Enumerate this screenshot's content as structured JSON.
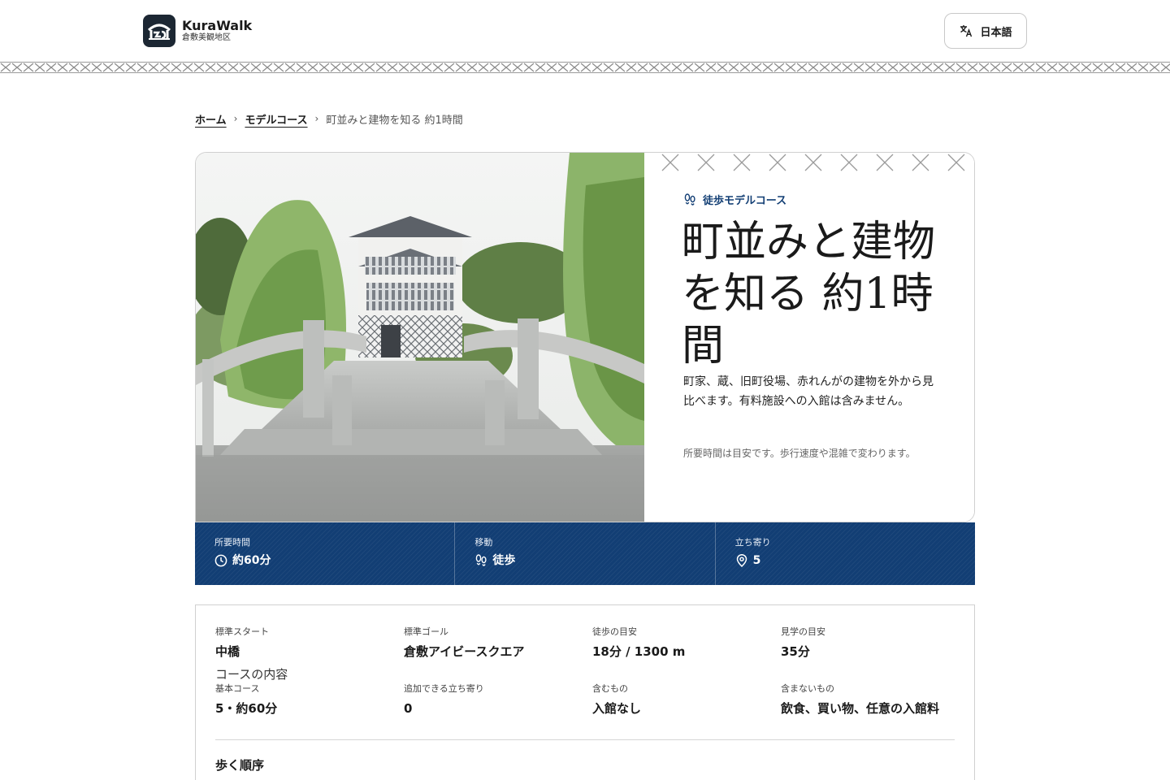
{
  "header": {
    "brand_name": "KuraWalk",
    "brand_sub": "倉敷美観地区",
    "language_label": "日本語"
  },
  "breadcrumb": {
    "home": "ホーム",
    "courses": "モデルコース",
    "current": "町並みと建物を知る 約1時間"
  },
  "hero": {
    "kind": "徒歩モデルコース",
    "title": "町並みと建物を知る 約1時間",
    "description": "町家、蔵、旧町役場、赤れんがの建物を外から見比べます。有料施設への入館は含みません。",
    "note": "所要時間は目安です。歩行速度や混雑で変わります。"
  },
  "stats": [
    {
      "label": "所要時間",
      "value": "約60分",
      "icon": "clock-icon"
    },
    {
      "label": "移動",
      "value": "徒歩",
      "icon": "footprints-icon"
    },
    {
      "label": "立ち寄り",
      "value": "5",
      "icon": "map-pin-icon"
    }
  ],
  "details": {
    "row1": [
      {
        "label": "標準スタート",
        "value": "中橋"
      },
      {
        "label": "標準ゴール",
        "value": "倉敷アイビースクエア"
      },
      {
        "label": "徒歩の目安",
        "value": "18分 / 1300 m"
      },
      {
        "label": "見学の目安",
        "value": "35分"
      }
    ],
    "contents_label": "コースの内容",
    "row2": [
      {
        "label": "基本コース",
        "value": "5・約60分"
      },
      {
        "label": "追加できる立ち寄り",
        "value": "0"
      },
      {
        "label": "含むもの",
        "value": "入館なし"
      },
      {
        "label": "含まないもの",
        "value": "飲食、買い物、任意の入館料"
      }
    ],
    "order_title": "歩く順序"
  },
  "colors": {
    "navy": "#123e74",
    "logo_bg": "#1c2733"
  }
}
